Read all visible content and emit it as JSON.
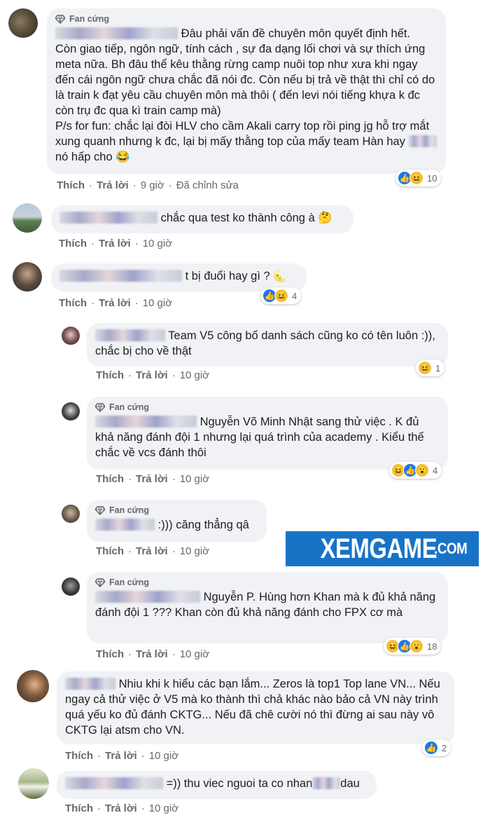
{
  "badge_label": "Fan cứng",
  "actions": {
    "like": "Thích",
    "reply": "Trả lời",
    "edited": "Đã chỉnh sửa"
  },
  "comments": [
    {
      "text": "Đâu phải vấn đề chuyên môn quyết định hết.\nCòn giao tiếp, ngôn ngữ, tính cách , sự đa dạng lối chơi và sự thích ứng meta nữa. Bh đâu thể kêu thằng rừng camp nuôi top như xưa khi ngay đến cái ngôn ngữ chưa chắc đã nói đc. Còn nếu bị trả về thật thì chỉ có do là train k đạt yêu cầu chuyên môn mà thôi ( đến levi nói tiếng khựa k đc còn trụ đc qua kì train camp mà)\nP/s for fun: chắc lại đòi HLV cho cầm Akali carry top rồi ping jg hỗ trợ mắt xung quanh nhưng k đc, lại bị mấy thằng top của mấy team Hàn hay",
      "tail": "nó hấp cho 😂",
      "time": "9 giờ",
      "reactions": "10"
    },
    {
      "text": "chắc qua test ko thành công à 🤔",
      "time": "10 giờ"
    },
    {
      "text": "t bị đuổi hay gì ? 🌜",
      "time": "10 giờ",
      "reactions": "4"
    },
    {
      "text": "Team V5 công bố danh sách cũng ko có tên luôn :)), chắc bị cho về thật",
      "time": "10 giờ",
      "reactions": "1"
    },
    {
      "text": "Nguyễn Võ Minh Nhật sang thử việc . K đủ khả năng đánh đội 1 nhưng lại quá trình của academy . Kiểu thế chắc về vcs đánh thôi",
      "time": "10 giờ",
      "reactions": "4"
    },
    {
      "text": ":))) căng thẳng qâ",
      "time": "10 giờ"
    },
    {
      "text": "Nguyễn P. Hùng hơn Khan mà k đủ khả năng đánh đội 1 ??? Khan còn đủ khả năng đánh cho FPX cơ mà",
      "time": "10 giờ",
      "reactions": "18"
    },
    {
      "text": "Nhiu khi k hiểu các bạn lắm... Zeros là top1 Top lane VN... Nếu ngay cả thử việc ở V5 mà ko thành thì chả khác nào bảo cả VN này trình quá yếu ko đủ đánh CKTG... Nếu đã chê cười nó thì đừng ai sau này vô CKTG lại atsm cho VN.",
      "time": "10 giờ",
      "reactions": "2"
    },
    {
      "text": "=)) thu viec nguoi ta co nhan",
      "tail": "dau",
      "time": "10 giờ"
    }
  ],
  "watermark": {
    "big": "XEMGAME",
    "small": ".COM",
    "color": "#1873c7"
  }
}
